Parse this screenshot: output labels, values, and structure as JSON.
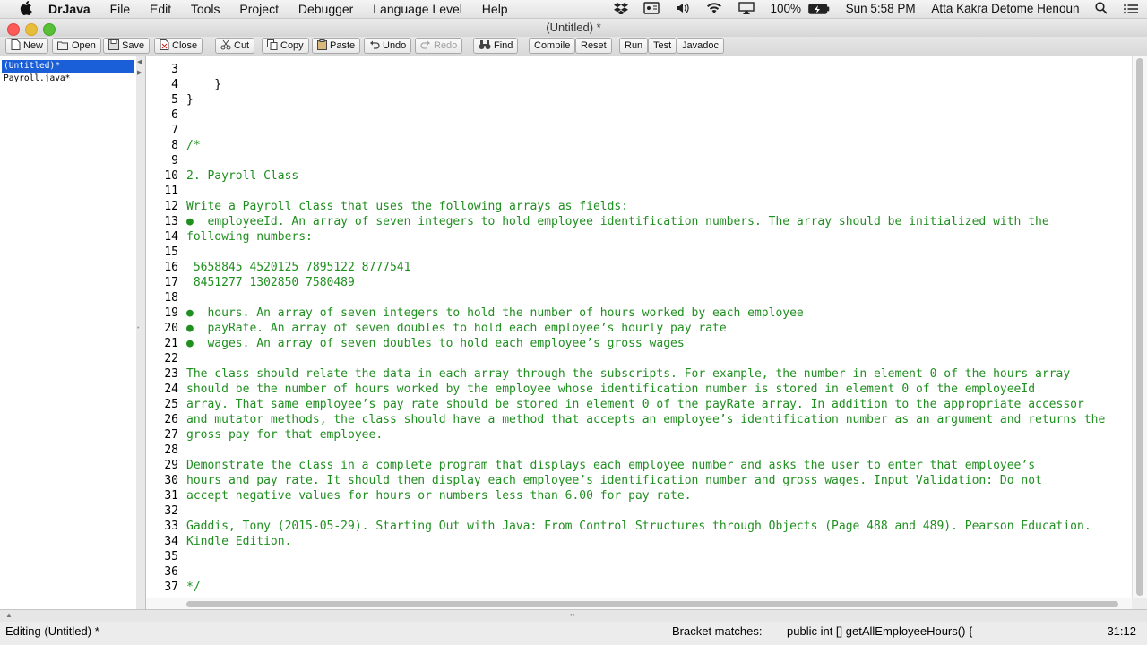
{
  "menubar": {
    "app_name": "DrJava",
    "items": [
      "File",
      "Edit",
      "Tools",
      "Project",
      "Debugger",
      "Language Level",
      "Help"
    ],
    "battery": "100%",
    "clock": "Sun 5:58 PM",
    "user": "Atta Kakra Detome Henoun"
  },
  "window": {
    "title": "(Untitled) *"
  },
  "toolbar": {
    "new": "New",
    "open": "Open",
    "save": "Save",
    "close": "Close",
    "cut": "Cut",
    "copy": "Copy",
    "paste": "Paste",
    "undo": "Undo",
    "redo": "Redo",
    "find": "Find",
    "compile": "Compile",
    "reset": "Reset",
    "run": "Run",
    "test": "Test",
    "javadoc": "Javadoc"
  },
  "files": [
    "(Untitled)*",
    "Payroll.java*"
  ],
  "editor": {
    "lines": [
      {
        "n": "3",
        "text": "",
        "comment": false
      },
      {
        "n": "4",
        "text": "    }",
        "comment": false
      },
      {
        "n": "5",
        "text": "}",
        "comment": false
      },
      {
        "n": "6",
        "text": "",
        "comment": false
      },
      {
        "n": "7",
        "text": "",
        "comment": false
      },
      {
        "n": "8",
        "text": "/*",
        "comment": true
      },
      {
        "n": "9",
        "text": "",
        "comment": true
      },
      {
        "n": "10",
        "text": "2. Payroll Class",
        "comment": true
      },
      {
        "n": "11",
        "text": "",
        "comment": true
      },
      {
        "n": "12",
        "text": "Write a Payroll class that uses the following arrays as fields:",
        "comment": true
      },
      {
        "n": "13",
        "text": "●  employeeId. An array of seven integers to hold employee identification numbers. The array should be initialized with the",
        "comment": true
      },
      {
        "n": "14",
        "text": "following numbers:",
        "comment": true
      },
      {
        "n": "15",
        "text": "",
        "comment": true
      },
      {
        "n": "16",
        "text": " 5658845 4520125 7895122 8777541",
        "comment": true
      },
      {
        "n": "17",
        "text": " 8451277 1302850 7580489",
        "comment": true
      },
      {
        "n": "18",
        "text": "",
        "comment": true
      },
      {
        "n": "19",
        "text": "●  hours. An array of seven integers to hold the number of hours worked by each employee",
        "comment": true
      },
      {
        "n": "20",
        "text": "●  payRate. An array of seven doubles to hold each employee’s hourly pay rate",
        "comment": true
      },
      {
        "n": "21",
        "text": "●  wages. An array of seven doubles to hold each employee’s gross wages",
        "comment": true
      },
      {
        "n": "22",
        "text": "",
        "comment": true
      },
      {
        "n": "23",
        "text": "The class should relate the data in each array through the subscripts. For example, the number in element 0 of the hours array",
        "comment": true
      },
      {
        "n": "24",
        "text": "should be the number of hours worked by the employee whose identification number is stored in element 0 of the employeeId",
        "comment": true
      },
      {
        "n": "25",
        "text": "array. That same employee’s pay rate should be stored in element 0 of the payRate array. In addition to the appropriate accessor",
        "comment": true
      },
      {
        "n": "26",
        "text": "and mutator methods, the class should have a method that accepts an employee’s identification number as an argument and returns the",
        "comment": true
      },
      {
        "n": "27",
        "text": "gross pay for that employee.",
        "comment": true
      },
      {
        "n": "28",
        "text": "",
        "comment": true
      },
      {
        "n": "29",
        "text": "Demonstrate the class in a complete program that displays each employee number and asks the user to enter that employee’s",
        "comment": true
      },
      {
        "n": "30",
        "text": "hours and pay rate. It should then display each employee’s identification number and gross wages. Input Validation: Do not",
        "comment": true
      },
      {
        "n": "31",
        "text": "accept negative values for hours or numbers less than 6.00 for pay rate.",
        "comment": true
      },
      {
        "n": "32",
        "text": "",
        "comment": true
      },
      {
        "n": "33",
        "text": "Gaddis, Tony (2015-05-29). Starting Out with Java: From Control Structures through Objects (Page 488 and 489). Pearson Education.",
        "comment": true
      },
      {
        "n": "34",
        "text": "Kindle Edition.",
        "comment": true
      },
      {
        "n": "35",
        "text": "",
        "comment": true
      },
      {
        "n": "36",
        "text": "",
        "comment": true
      },
      {
        "n": "37",
        "text": "*/",
        "comment": true
      }
    ]
  },
  "statusbar": {
    "left": "Editing (Untitled) *",
    "bracket_label": "Bracket matches:",
    "bracket_value": "public int [] getAllEmployeeHours() {",
    "cursor": "31:12"
  }
}
